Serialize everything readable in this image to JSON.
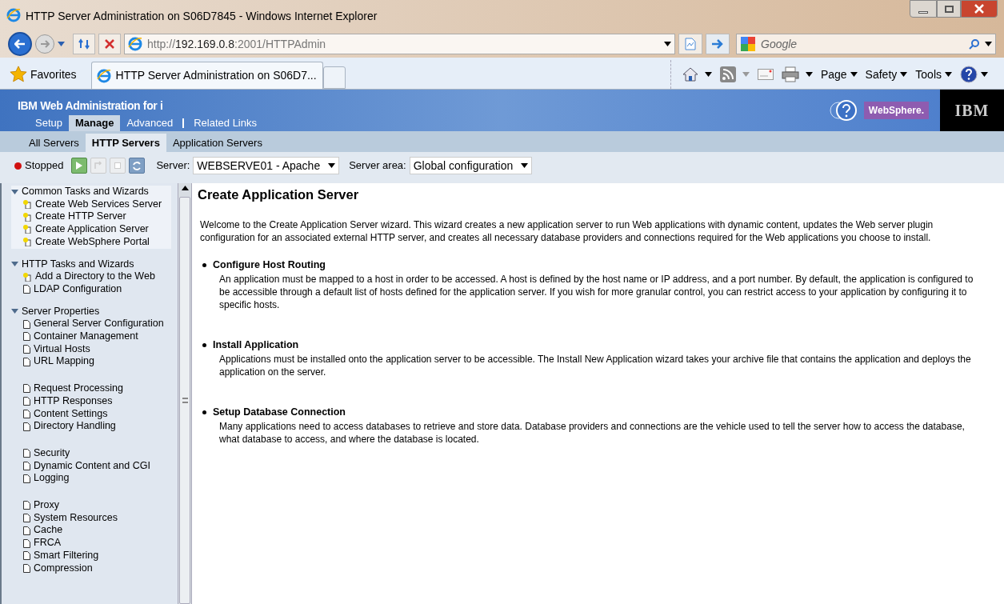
{
  "window": {
    "title": "HTTP Server Administration on S06D7845 - Windows Internet Explorer"
  },
  "address_bar": {
    "url_prefix": "http://",
    "url_host": "192.169.0.8",
    "url_rest": ":2001/HTTPAdmin"
  },
  "search": {
    "placeholder": "Google"
  },
  "favorites": {
    "label": "Favorites"
  },
  "browser_tabs": [
    {
      "label": "HTTP Server Administration on S06D7...",
      "selected": true
    }
  ],
  "command_bar": [
    "Page",
    "Safety",
    "Tools"
  ],
  "app_header": {
    "title": "IBM Web Administration for i",
    "brand": "WebSphere.",
    "logo": "IBM"
  },
  "main_tabs": [
    {
      "label": "Setup",
      "selected": false
    },
    {
      "label": "Manage",
      "selected": true
    },
    {
      "label": "Advanced",
      "selected": false
    },
    {
      "label": "Related Links",
      "selected": false
    }
  ],
  "sub_tabs": [
    {
      "label": "All Servers",
      "selected": false
    },
    {
      "label": "HTTP Servers",
      "selected": true
    },
    {
      "label": "Application Servers",
      "selected": false
    }
  ],
  "toolbar": {
    "status": "Stopped",
    "running": false,
    "server_label": "Server:",
    "server_value": "WEBSERVE01 - Apache",
    "area_label": "Server area:",
    "area_value": "Global configuration"
  },
  "sidebar": {
    "groups": [
      {
        "label": "Common Tasks and Wizards",
        "expanded": true,
        "selected": true,
        "sections": [
          [
            {
              "label": "Create Web Services Server",
              "kind": "wizard"
            },
            {
              "label": "Create HTTP Server",
              "kind": "wizard"
            },
            {
              "label": "Create Application Server",
              "kind": "wizard"
            },
            {
              "label": "Create WebSphere Portal",
              "kind": "wizard"
            }
          ]
        ]
      },
      {
        "label": "HTTP Tasks and Wizards",
        "expanded": true,
        "selected": false,
        "sections": [
          [
            {
              "label": "Add a Directory to the Web",
              "kind": "wizard"
            },
            {
              "label": "LDAP Configuration",
              "kind": "page"
            }
          ]
        ]
      },
      {
        "label": "Server Properties",
        "expanded": true,
        "selected": false,
        "sections": [
          [
            {
              "label": "General Server Configuration",
              "kind": "page"
            },
            {
              "label": "Container Management",
              "kind": "page"
            },
            {
              "label": "Virtual Hosts",
              "kind": "page"
            },
            {
              "label": "URL Mapping",
              "kind": "page"
            }
          ],
          [
            {
              "label": "Request Processing",
              "kind": "page"
            },
            {
              "label": "HTTP Responses",
              "kind": "page"
            },
            {
              "label": "Content Settings",
              "kind": "page"
            },
            {
              "label": "Directory Handling",
              "kind": "page"
            }
          ],
          [
            {
              "label": "Security",
              "kind": "page"
            },
            {
              "label": "Dynamic Content and CGI",
              "kind": "page"
            },
            {
              "label": "Logging",
              "kind": "page"
            }
          ],
          [
            {
              "label": "Proxy",
              "kind": "page"
            },
            {
              "label": "System Resources",
              "kind": "page"
            },
            {
              "label": "Cache",
              "kind": "page"
            },
            {
              "label": "FRCA",
              "kind": "page"
            },
            {
              "label": "Smart Filtering",
              "kind": "page"
            },
            {
              "label": "Compression",
              "kind": "page"
            }
          ]
        ]
      }
    ]
  },
  "content": {
    "heading": "Create Application Server",
    "intro": "Welcome to the Create Application Server wizard. This wizard creates a new application server to run Web applications with dynamic content, updates the Web server plugin configuration for an associated external HTTP server, and creates all necessary database providers and connections required for the Web applications you choose to install.",
    "steps": [
      {
        "title": "Configure Host Routing",
        "text": "An application must be mapped to a host in order to be accessed. A host is defined by the host name or IP address, and a port number. By default, the application is configured to be accessible through a default list of hosts defined for the application server. If you wish for more granular control, you can restrict access to your application by configuring it to specific hosts."
      },
      {
        "title": "Install Application",
        "text": "Applications must be installed onto the application server to be accessible. The Install New Application wizard takes your archive file that contains the application and deploys the application on the server."
      },
      {
        "title": "Setup Database Connection",
        "text": "Many applications need to access databases to retrieve and store data. Database providers and connections are the vehicle used to tell the server how to access the database, what database to access, and where the database is located."
      }
    ]
  }
}
